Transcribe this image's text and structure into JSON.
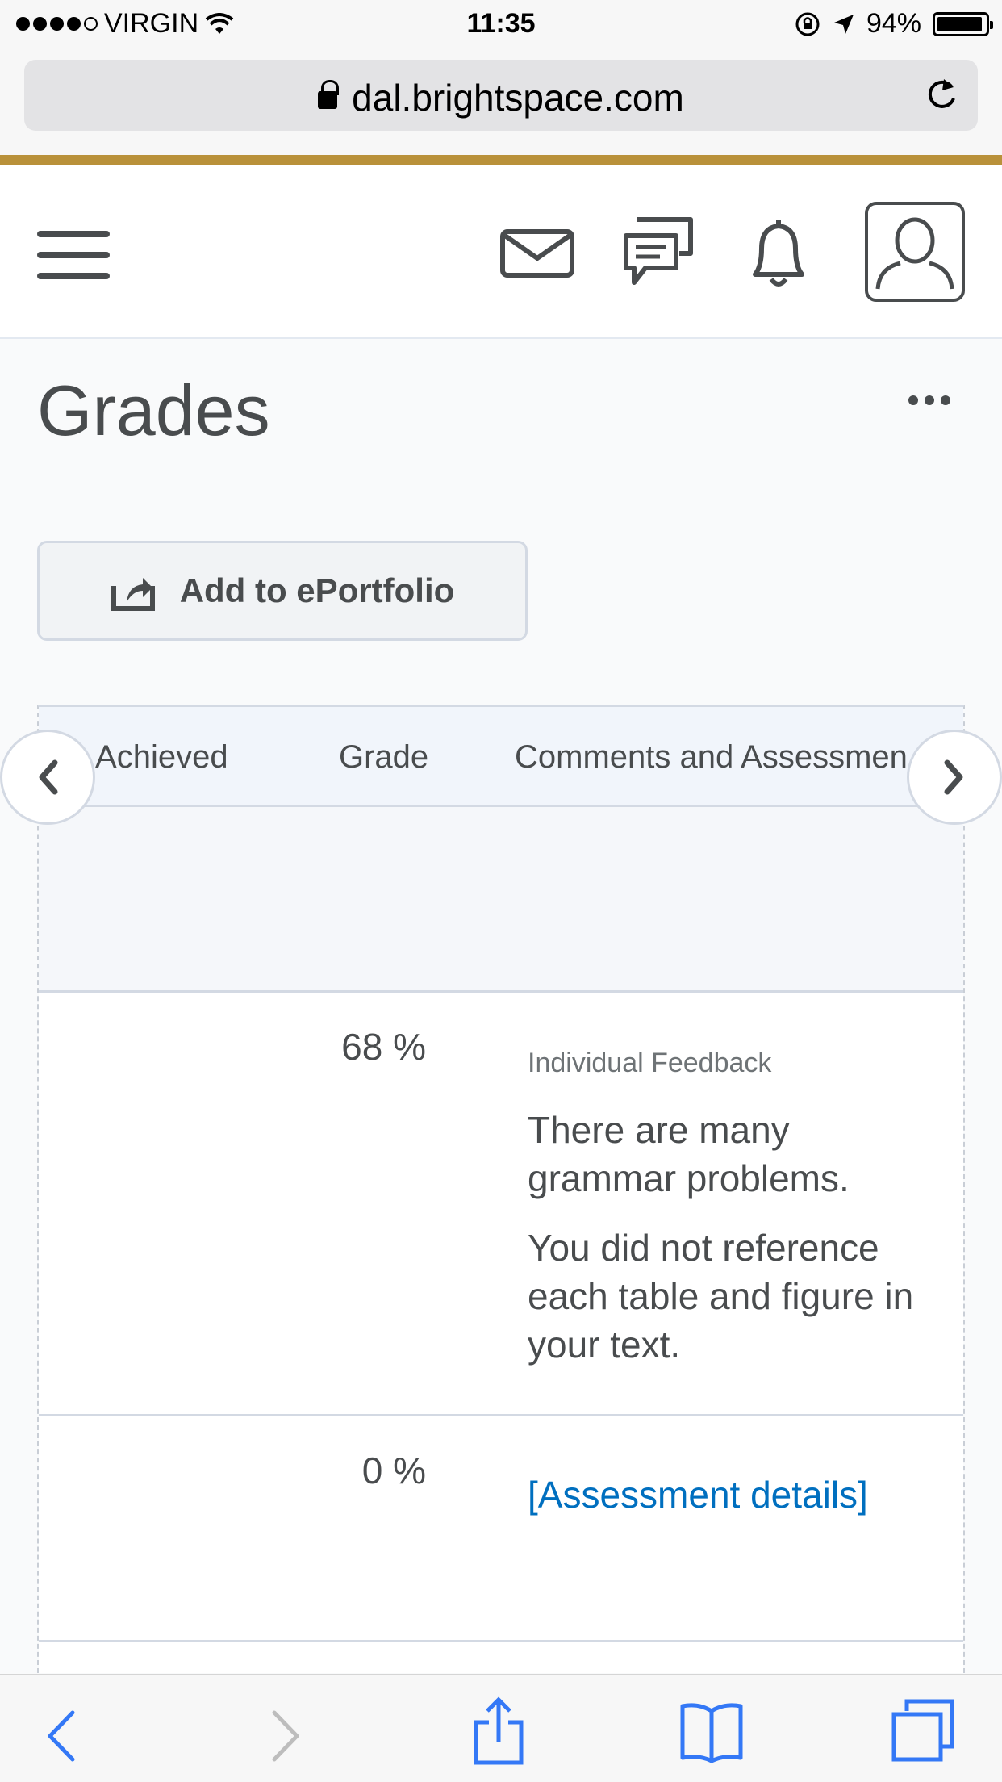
{
  "status_bar": {
    "carrier": "VIRGIN",
    "time": "11:35",
    "battery": "94%"
  },
  "browser": {
    "url": "dal.brightspace.com"
  },
  "page": {
    "title": "Grades",
    "add_to_eportfolio": "Add to ePortfolio"
  },
  "table": {
    "headers": [
      "t Achieved",
      "Grade",
      "Comments and Assessmen"
    ],
    "rows": [
      {
        "grade": "68 %",
        "feedback_label": "Individual Feedback",
        "feedback": [
          "There are many grammar problems.",
          "You did not reference each table and figure in your text."
        ]
      },
      {
        "grade": "0 %",
        "link": "[Assessment details]"
      }
    ]
  },
  "colors": {
    "accent_gold": "#b9913a",
    "link": "#006fbf",
    "text": "#494c4e"
  },
  "icons": [
    "menu-icon",
    "mail-icon",
    "chat-icon",
    "bell-icon",
    "user-avatar-icon",
    "more-icon",
    "eportfolio-icon",
    "chevron-left-icon",
    "chevron-right-icon",
    "back-icon",
    "forward-icon",
    "share-icon",
    "bookmarks-icon",
    "tabs-icon"
  ]
}
